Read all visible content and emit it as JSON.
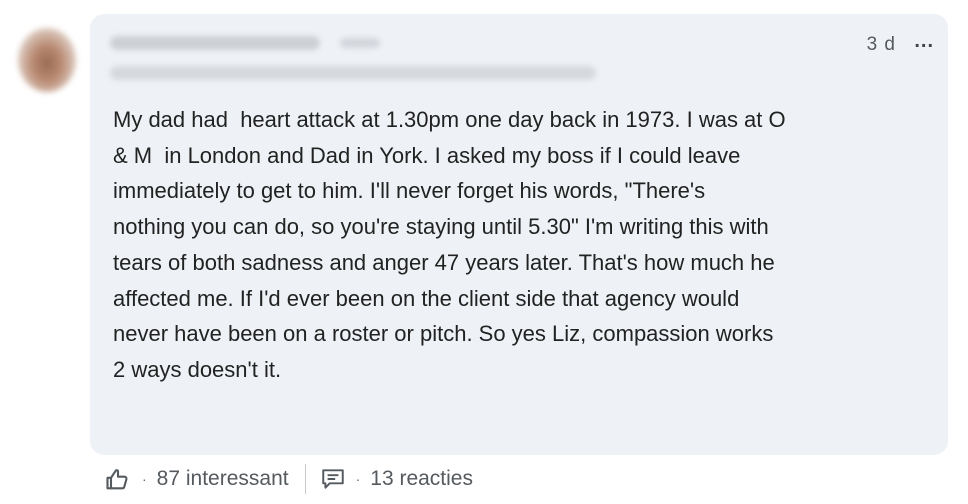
{
  "comment": {
    "timestamp": "3 d",
    "more_label": "...",
    "text": "My dad had  heart attack at 1.30pm one day back in 1973. I was at O\n& M  in London and Dad in York. I asked my boss if I could leave\nimmediately to get to him. I'll never forget his words, \"There's\nnothing you can do, so you're staying until 5.30\" I'm writing this with\ntears of both sadness and anger 47 years later. That's how much he\naffected me. If I'd ever been on the client side that agency would\nnever have been on a roster or pitch. So yes Liz, compassion works\n2 ways doesn't it."
  },
  "actions": {
    "separator": "·",
    "reactions_label": "87 interessant",
    "replies_label": "13 reacties"
  },
  "icons": {
    "reaction": "thumbs-up-icon",
    "reply": "comment-icon"
  }
}
